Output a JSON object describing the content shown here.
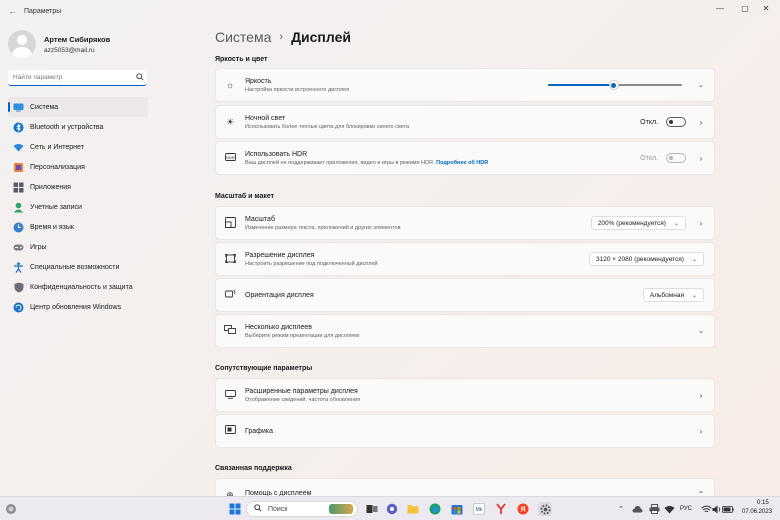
{
  "window": {
    "title": "Параметры",
    "back_icon": "arrow-left-icon",
    "min": "—",
    "max": "▢",
    "close": "✕"
  },
  "profile": {
    "name": "Артем Сибиряков",
    "email": "azz5053@mail.ru"
  },
  "search": {
    "placeholder": "Найти параметр",
    "icon": "search-icon"
  },
  "nav": [
    {
      "label": "Система",
      "icon": "monitor-icon",
      "active": true
    },
    {
      "label": "Bluetooth и устройства",
      "icon": "bluetooth-icon"
    },
    {
      "label": "Сеть и Интернет",
      "icon": "network-icon"
    },
    {
      "label": "Персонализация",
      "icon": "brush-icon"
    },
    {
      "label": "Приложения",
      "icon": "apps-icon"
    },
    {
      "label": "Учетные записи",
      "icon": "account-icon"
    },
    {
      "label": "Время и язык",
      "icon": "globe-clock-icon"
    },
    {
      "label": "Игры",
      "icon": "gamepad-icon"
    },
    {
      "label": "Специальные возможности",
      "icon": "accessibility-icon"
    },
    {
      "label": "Конфиденциальность и защита",
      "icon": "shield-icon"
    },
    {
      "label": "Центр обновления Windows",
      "icon": "update-icon"
    }
  ],
  "breadcrumb": {
    "parent": "Система",
    "separator": "›",
    "current": "Дисплей"
  },
  "sections": {
    "brightness_color": "Яркость и цвет",
    "scale_layout": "Масштаб и макет",
    "related_settings": "Сопутствующие параметры",
    "related_support": "Связанная поддержка"
  },
  "brightness": {
    "title": "Яркость",
    "desc": "Настройка яркости встроенного дисплея",
    "value": 0.49
  },
  "night_light": {
    "title": "Ночной свет",
    "desc": "Использовать более теплые цвета для блокировки синего света",
    "state": "Откл."
  },
  "hdr": {
    "title": "Использовать HDR",
    "desc": "Ваш дисплей не поддерживает приложения, видео и игры в режиме HDR.",
    "link": "Подробнее об HDR",
    "state": "Откл."
  },
  "scale": {
    "title": "Масштаб",
    "desc": "Изменение размера текста, приложений и других элементов",
    "value": "200% (рекомендуется)"
  },
  "resolution": {
    "title": "Разрешение дисплея",
    "desc": "Настроить разрешение под подключенный дисплей",
    "value": "3120 × 2080 (рекомендуется)"
  },
  "orientation": {
    "title": "Ориентация дисплея",
    "value": "Альбомная"
  },
  "multiple": {
    "title": "Несколько дисплеев",
    "desc": "Выберите режим презентации для дисплеев"
  },
  "advanced": {
    "title": "Расширенные параметры дисплея",
    "desc": "Отображение сведений, частота обновления"
  },
  "graphics": {
    "title": "Графика"
  },
  "support": {
    "title": "Помощь с дисплеем"
  },
  "taskbar": {
    "search_label": "Поиск",
    "language": "РУС",
    "time": "0:15",
    "date": "07.06.2023"
  },
  "colors": {
    "accent": "#0067c0"
  }
}
